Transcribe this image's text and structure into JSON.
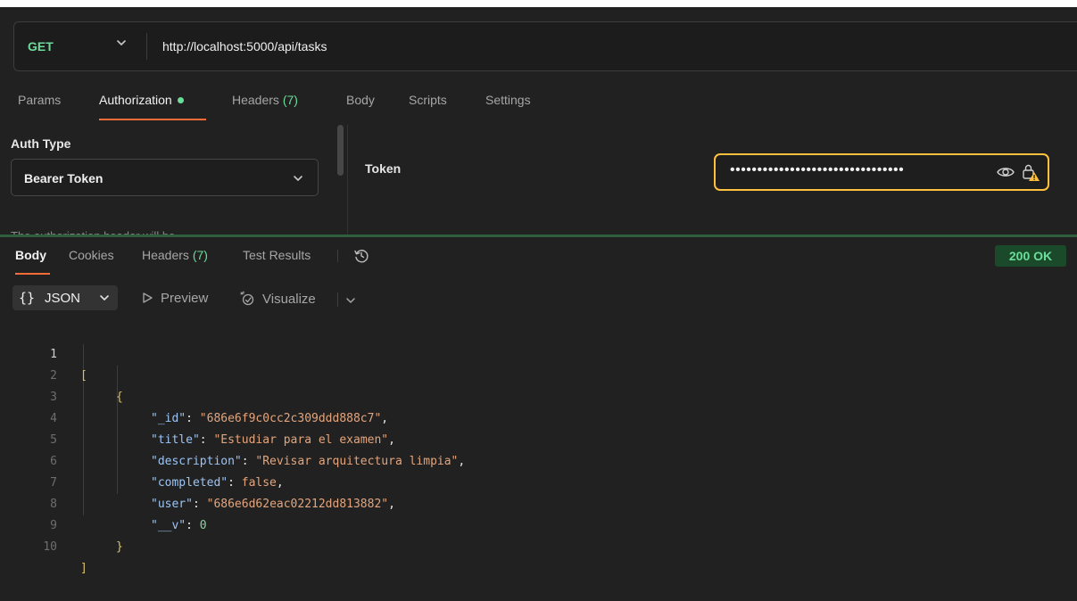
{
  "request": {
    "method": "GET",
    "url": "http://localhost:5000/api/tasks"
  },
  "request_tabs": {
    "params": "Params",
    "authorization": "Authorization",
    "headers": "Headers",
    "headers_count": "(7)",
    "body": "Body",
    "scripts": "Scripts",
    "settings": "Settings"
  },
  "auth": {
    "type_label": "Auth Type",
    "type_value": "Bearer Token",
    "note": "The authorization header will be",
    "token_label": "Token",
    "token_masked": "••••••••••••••••••••••••••••••••"
  },
  "response_tabs": {
    "body": "Body",
    "cookies": "Cookies",
    "headers": "Headers",
    "headers_count": "(7)",
    "test_results": "Test Results"
  },
  "status": "200 OK",
  "format": {
    "braces": "{}",
    "selected": "JSON",
    "preview": "Preview",
    "visualize": "Visualize"
  },
  "code_lines": [
    "1",
    "2",
    "3",
    "4",
    "5",
    "6",
    "7",
    "8",
    "9",
    "10"
  ],
  "json_body": {
    "open_array": "[",
    "open_object": "{",
    "fields": [
      {
        "key": "\"_id\"",
        "value": "\"686e6f9c0cc2c309ddd888c7\"",
        "type": "string"
      },
      {
        "key": "\"title\"",
        "value": "\"Estudiar para el examen\"",
        "type": "string"
      },
      {
        "key": "\"description\"",
        "value": "\"Revisar arquitectura limpia\"",
        "type": "string"
      },
      {
        "key": "\"completed\"",
        "value": "false",
        "type": "bool"
      },
      {
        "key": "\"user\"",
        "value": "\"686e6d62eac02212dd813882\"",
        "type": "string"
      },
      {
        "key": "\"__v\"",
        "value": "0",
        "type": "number"
      }
    ],
    "close_object": "}",
    "close_array": "]"
  },
  "colors": {
    "accent": "#ff6c37",
    "method_get": "#6bdd9a",
    "token_border": "#ffc13d",
    "status_bg": "#1b4a2a"
  },
  "icons": [
    "chevron-down-icon",
    "eye-icon",
    "lock-warning-icon",
    "history-icon",
    "play-icon",
    "visualize-icon"
  ]
}
